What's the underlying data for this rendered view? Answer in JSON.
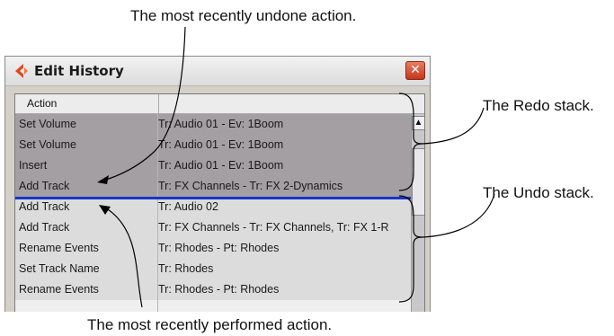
{
  "annotations": {
    "undone": "The most recently undone action.",
    "redo_stack": "The Redo stack.",
    "undo_stack": "The Undo stack.",
    "performed": "The most recently performed action."
  },
  "window": {
    "title": "Edit History",
    "close_glyph": "✕",
    "app_icon": "cubase-logo-icon"
  },
  "table": {
    "header_action": "Action",
    "redo_rows": [
      {
        "action": "Set Volume",
        "target": "Tr: Audio 01 - Ev: 1Boom"
      },
      {
        "action": "Set Volume",
        "target": "Tr: Audio 01 - Ev: 1Boom"
      },
      {
        "action": "Insert",
        "target": "Tr: Audio 01 - Ev: 1Boom"
      },
      {
        "action": "Add Track",
        "target": "Tr: FX Channels - Tr: FX 2-Dynamics"
      }
    ],
    "undo_rows": [
      {
        "action": "Add Track",
        "target": "Tr: Audio 02"
      },
      {
        "action": "Add Track",
        "target": "Tr: FX Channels - Tr: FX Channels, Tr: FX 1-R"
      },
      {
        "action": "Rename Events",
        "target": "Tr: Rhodes - Pt: Rhodes"
      },
      {
        "action": "Set Track Name",
        "target": "Tr: Rhodes"
      },
      {
        "action": "Rename Events",
        "target": "Tr: Rhodes - Pt: Rhodes"
      }
    ]
  },
  "colors": {
    "redo_bg": "#a39fa3",
    "undo_bg": "#dcdcdc",
    "boundary": "#1636c8",
    "close_button": "#d24a2c"
  }
}
